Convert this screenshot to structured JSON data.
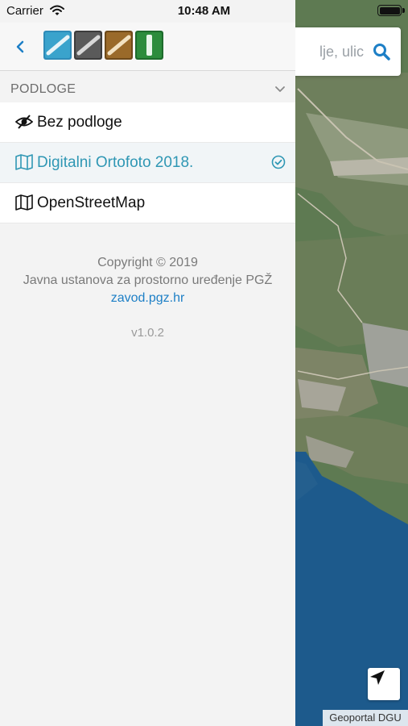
{
  "status_bar": {
    "carrier": "Carrier",
    "time": "10:48 AM",
    "battery_level": 1.0
  },
  "drawer": {
    "back_icon": "chevron-left-icon",
    "logo": "zzpu-logo",
    "section": {
      "title": "PODLOGE",
      "chevron_icon": "chevron-down-icon"
    },
    "layers": [
      {
        "label": "Bez podloge",
        "icon": "eye-slash-icon",
        "selected": false
      },
      {
        "label": "Digitalni Ortofoto 2018.",
        "icon": "map-icon",
        "selected": true
      },
      {
        "label": "OpenStreetMap",
        "icon": "map-icon",
        "selected": false
      }
    ],
    "copyright": "Copyright © 2019",
    "organization": "Javna ustanova za prostorno uređenje PGŽ",
    "link": "zavod.pgz.hr",
    "version": "v1.0.2"
  },
  "map": {
    "search_value": "lje, ulic",
    "search_icon": "search-icon",
    "locate_icon": "location-arrow-icon",
    "attribution": "Geoportal DGU"
  },
  "colors": {
    "accent": "#2f97b4",
    "link": "#1d7fc6",
    "sea": "#1d5a8c",
    "land": "#5c7850"
  }
}
